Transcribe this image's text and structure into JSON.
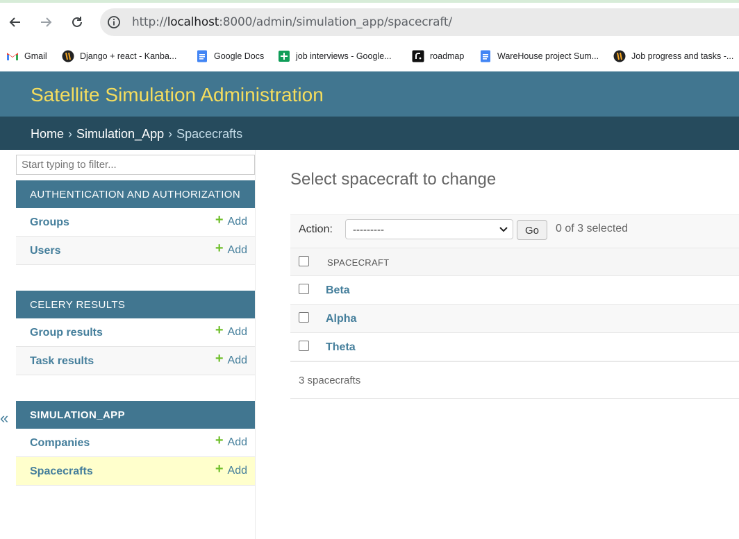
{
  "browser": {
    "url_scheme": "http://",
    "url_host": "localhost",
    "url_rest": ":8000/admin/simulation_app/spacecraft/",
    "bookmarks": [
      {
        "label": "Gmail",
        "icon": "gmail-icon"
      },
      {
        "label": "Django + react - Kanba...",
        "icon": "kanban-icon"
      },
      {
        "label": "Google Docs",
        "icon": "google-docs-icon"
      },
      {
        "label": "job interviews - Google...",
        "icon": "google-sheets-icon"
      },
      {
        "label": "roadmap",
        "icon": "roadmap-icon"
      },
      {
        "label": "WareHouse project Sum...",
        "icon": "google-docs-icon"
      },
      {
        "label": "Job progress and tasks -...",
        "icon": "kanban-icon"
      }
    ]
  },
  "header": {
    "site_title": "Satellite Simulation Administration"
  },
  "breadcrumbs": {
    "home": "Home",
    "app": "Simulation_App",
    "current": "Spacecrafts",
    "separator": "›"
  },
  "sidebar": {
    "filter_placeholder": "Start typing to filter...",
    "add_label": "Add",
    "collapse_glyph": "«",
    "modules": [
      {
        "caption": "AUTHENTICATION AND AUTHORIZATION",
        "models": [
          "Groups",
          "Users"
        ]
      },
      {
        "caption": "CELERY RESULTS",
        "models": [
          "Group results",
          "Task results"
        ]
      },
      {
        "caption": "SIMULATION_APP",
        "models": [
          "Companies",
          "Spacecrafts"
        ]
      }
    ]
  },
  "main": {
    "title": "Select spacecraft to change",
    "action_label": "Action:",
    "action_selected": "---------",
    "go_label": "Go",
    "selection_counter": "0 of 3 selected",
    "column_header": "SPACECRAFT",
    "rows": [
      "Beta",
      "Alpha",
      "Theta"
    ],
    "result_count": "3 spacecrafts"
  },
  "colors": {
    "header_bg": "#417690",
    "breadcrumbs_bg": "#264b5d",
    "brand_text": "#f5dd5d",
    "link": "#447e9b",
    "add_plus": "#70bf2b",
    "current_row": "#ffffcc"
  }
}
